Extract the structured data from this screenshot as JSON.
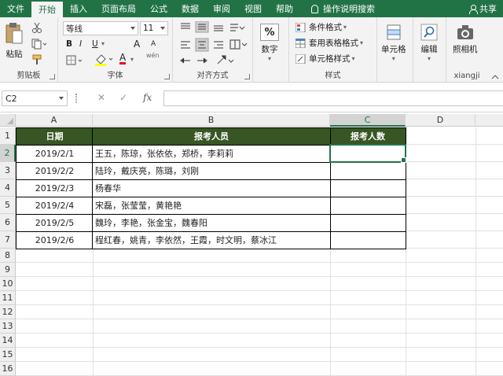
{
  "menu": {
    "tabs": [
      "文件",
      "开始",
      "插入",
      "页面布局",
      "公式",
      "数据",
      "审阅",
      "视图",
      "帮助"
    ],
    "active": 1,
    "search": "操作说明搜索",
    "share": "共享"
  },
  "ribbon": {
    "clipboard": {
      "paste": "粘贴",
      "label": "剪贴板"
    },
    "font": {
      "name": "等线",
      "size": "11",
      "label": "字体",
      "bold": "B",
      "italic": "I",
      "underline": "U",
      "grow": "A",
      "shrink": "A",
      "color_a": "A",
      "wen": "wén"
    },
    "alignment": {
      "label": "对齐方式"
    },
    "number": {
      "label": "数字",
      "symbol": "%"
    },
    "styles": {
      "conditional": "条件格式",
      "table": "套用表格格式",
      "cell": "单元格样式",
      "label": "样式"
    },
    "cells": {
      "label": "单元格"
    },
    "editing": {
      "label": "编辑"
    },
    "camera": {
      "label": "照相机",
      "group": "xiangji"
    }
  },
  "formula_bar": {
    "namebox": "C2",
    "cancel": "✕",
    "confirm": "✓",
    "fx": "fx",
    "value": ""
  },
  "sheet": {
    "columns": [
      "A",
      "B",
      "C",
      "D"
    ],
    "selected_column": "C",
    "selected_row": 2,
    "rows": [
      "1",
      "2",
      "3",
      "4",
      "5",
      "6",
      "7",
      "8",
      "9",
      "10",
      "11",
      "12",
      "13",
      "14",
      "15",
      "16"
    ],
    "header": [
      "日期",
      "报考人员",
      "报考人数"
    ],
    "data": [
      {
        "date": "2019/2/1",
        "people": "王五，陈琼，张依依，郑桥，李莉莉",
        "count": ""
      },
      {
        "date": "2019/2/2",
        "people": "陆玲，戴庆亮，陈璐，刘刚",
        "count": ""
      },
      {
        "date": "2019/2/3",
        "people": "杨春华",
        "count": ""
      },
      {
        "date": "2019/2/4",
        "people": "宋磊，张莹莹，黄艳艳",
        "count": ""
      },
      {
        "date": "2019/2/5",
        "people": "魏玲，李艳，张金宝，魏春阳",
        "count": ""
      },
      {
        "date": "2019/2/6",
        "people": "程红春，姚青，李依然，王霞，时文明，蔡冰江",
        "count": ""
      }
    ]
  },
  "colors": {
    "accent": "#217346",
    "header_fill": "#375623"
  }
}
